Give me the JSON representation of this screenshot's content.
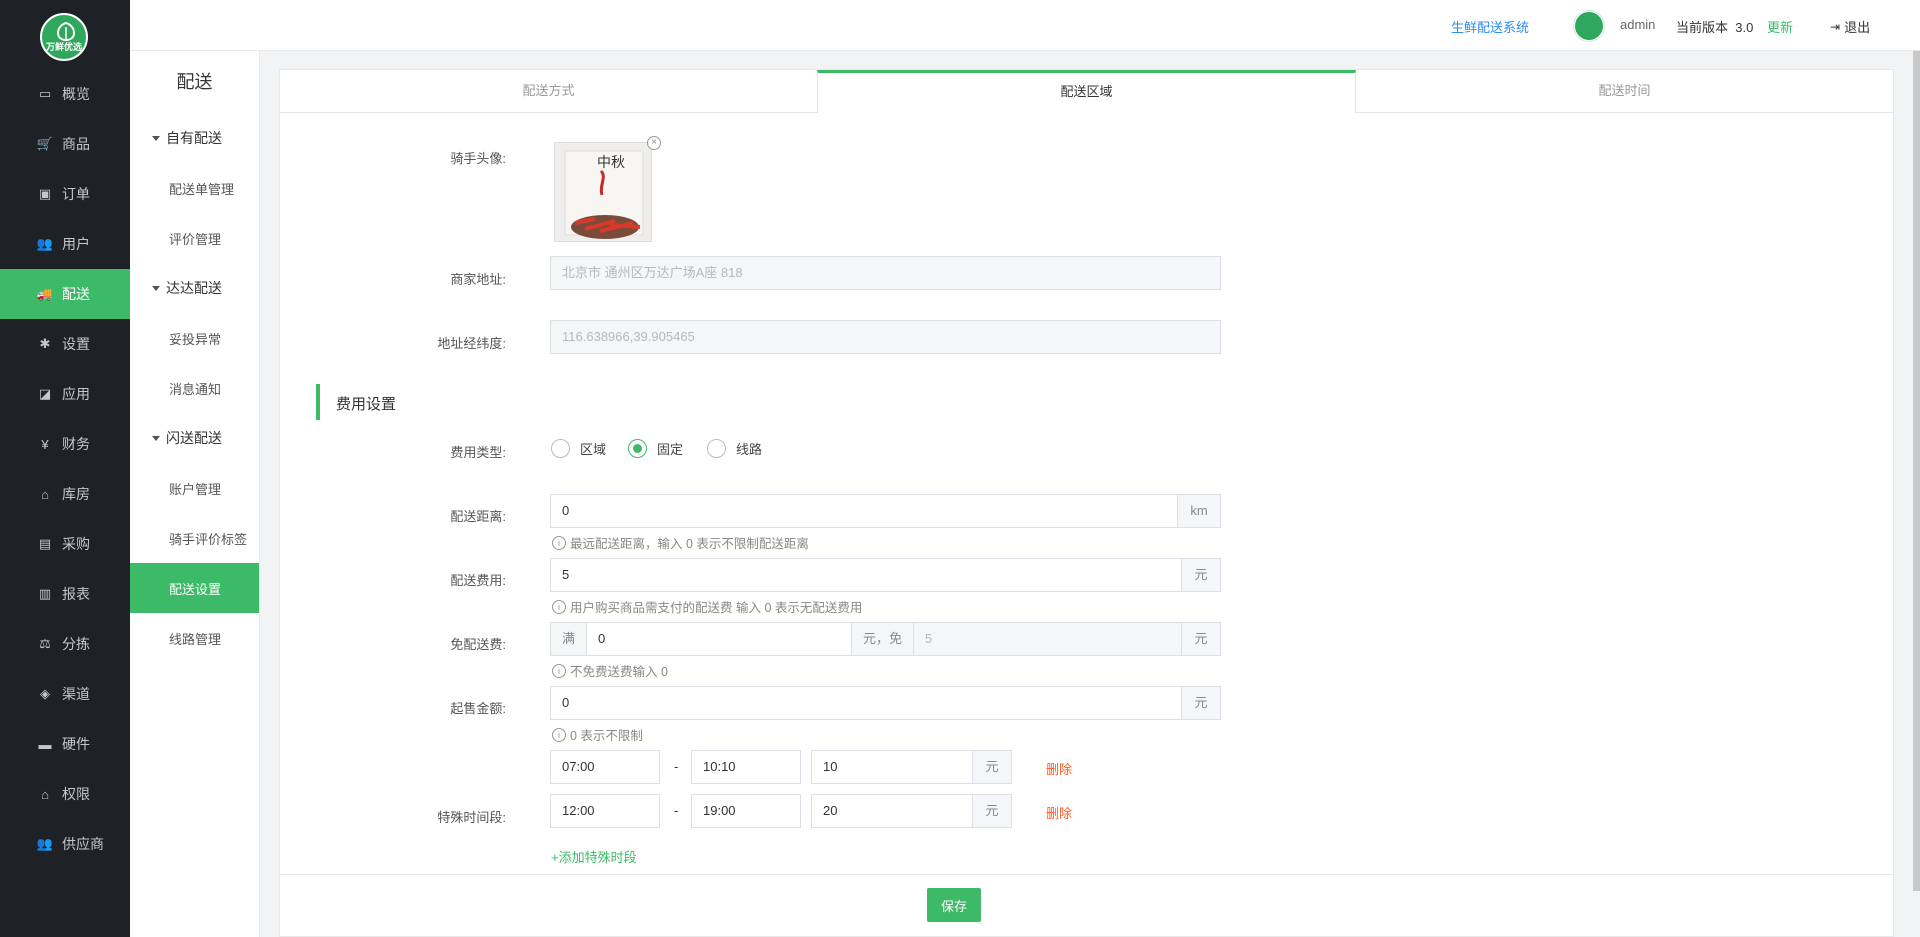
{
  "brand": {
    "logo_text": "万鲜优选"
  },
  "sidebar": {
    "items": [
      {
        "label": "概览",
        "icon": "monitor-icon",
        "glyph": "▭"
      },
      {
        "label": "商品",
        "icon": "cart-icon",
        "glyph": "🛒"
      },
      {
        "label": "订单",
        "icon": "money-icon",
        "glyph": "▣"
      },
      {
        "label": "用户",
        "icon": "users-icon",
        "glyph": "👥"
      },
      {
        "label": "配送",
        "icon": "truck-icon",
        "glyph": "🚚"
      },
      {
        "label": "设置",
        "icon": "puzzle-icon",
        "glyph": "✱"
      },
      {
        "label": "应用",
        "icon": "apps-icon",
        "glyph": "◪"
      },
      {
        "label": "财务",
        "icon": "yen-icon",
        "glyph": "¥"
      },
      {
        "label": "库房",
        "icon": "home-icon",
        "glyph": "⌂"
      },
      {
        "label": "采购",
        "icon": "bus-icon",
        "glyph": "▤"
      },
      {
        "label": "报表",
        "icon": "bar-chart-icon",
        "glyph": "▥"
      },
      {
        "label": "分拣",
        "icon": "scale-icon",
        "glyph": "⚖"
      },
      {
        "label": "渠道",
        "icon": "cube-icon",
        "glyph": "◈"
      },
      {
        "label": "硬件",
        "icon": "desktop-icon",
        "glyph": "▬"
      },
      {
        "label": "权限",
        "icon": "bank-icon",
        "glyph": "⌂"
      },
      {
        "label": "供应商",
        "icon": "suppliers-icon",
        "glyph": "👥"
      }
    ]
  },
  "subnav": {
    "title": "配送",
    "groups": [
      {
        "label": "自有配送",
        "items": [
          "配送单管理",
          "评价管理"
        ]
      },
      {
        "label": "达达配送",
        "items": [
          "妥投异常",
          "消息通知"
        ]
      },
      {
        "label": "闪送配送",
        "items": [
          "账户管理",
          "骑手评价标签",
          "配送设置",
          "线路管理"
        ]
      }
    ]
  },
  "header": {
    "system_link": "生鲜配送系统",
    "user": "admin",
    "version_label": "当前版本",
    "version": "3.0",
    "update_label": "更新",
    "logout_label": "退出"
  },
  "tabs": [
    "配送方式",
    "配送区域",
    "配送时间"
  ],
  "form": {
    "rider_avatar_label": "骑手头像:",
    "avatar_image_text": "中秋",
    "merchant_address_label": "商家地址:",
    "merchant_address_value": "北京市 通州区万达广场A座 818",
    "coords_label": "地址经纬度:",
    "coords_value": "116.638966,39.905465",
    "section_title": "费用设置",
    "fee_type_label": "费用类型:",
    "fee_types": [
      "区域",
      "固定",
      "线路"
    ],
    "fee_type_selected": "固定",
    "distance_label": "配送距离:",
    "distance_value": "0",
    "distance_unit": "km",
    "distance_hint": "最远配送距离，输入 0 表示不限制配送距离",
    "fee_label": "配送费用:",
    "fee_value": "5",
    "yuan": "元",
    "fee_hint": "用户购买商品需支付的配送费 输入 0 表示无配送费用",
    "free_label": "免配送费:",
    "free_prefix": "满",
    "free_threshold": "0",
    "free_mid": "元，免",
    "free_amount_placeholder": "5",
    "free_hint": "不免费送费输入 0",
    "min_label": "起售金额:",
    "min_value": "0",
    "min_hint": "0 表示不限制",
    "special_label": "特殊时间段:",
    "special_periods": [
      {
        "start": "07:00",
        "end": "10:10",
        "fee": "10"
      },
      {
        "start": "12:00",
        "end": "19:00",
        "fee": "20"
      }
    ],
    "dash": "-",
    "delete_label": "删除",
    "add_period_label": "+添加特殊时段",
    "save_label": "保存"
  }
}
